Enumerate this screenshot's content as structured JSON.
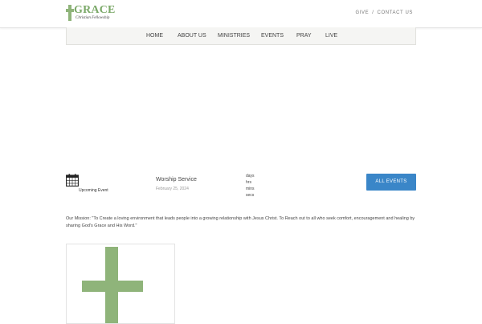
{
  "header": {
    "logo_word": "GRACE",
    "logo_subtitle": "Christian Fellowship",
    "links": [
      "GIVE",
      "CONTACT US"
    ]
  },
  "nav": {
    "items": [
      "HOME",
      "ABOUT US",
      "MINISTRIES",
      "EVENTS",
      "PRAY",
      "LIVE"
    ]
  },
  "upcoming": {
    "label": "Upcoming Event",
    "event_title": "Worship Service",
    "event_date": "February 25, 2024",
    "countdown_units": [
      "days",
      "hrs",
      "mins",
      "secs"
    ],
    "button_label": "ALL EVENTS"
  },
  "mission": {
    "text": "Our Mission: \"To Create a loving environment that leads people into a growing relationship with Jesus Christ. To Reach out to all who seek comfort, encouragement and healing by sharing God's Grace and His Word.\""
  },
  "colors": {
    "brand_green": "#8fb47a",
    "button_blue": "#3a86c8"
  }
}
